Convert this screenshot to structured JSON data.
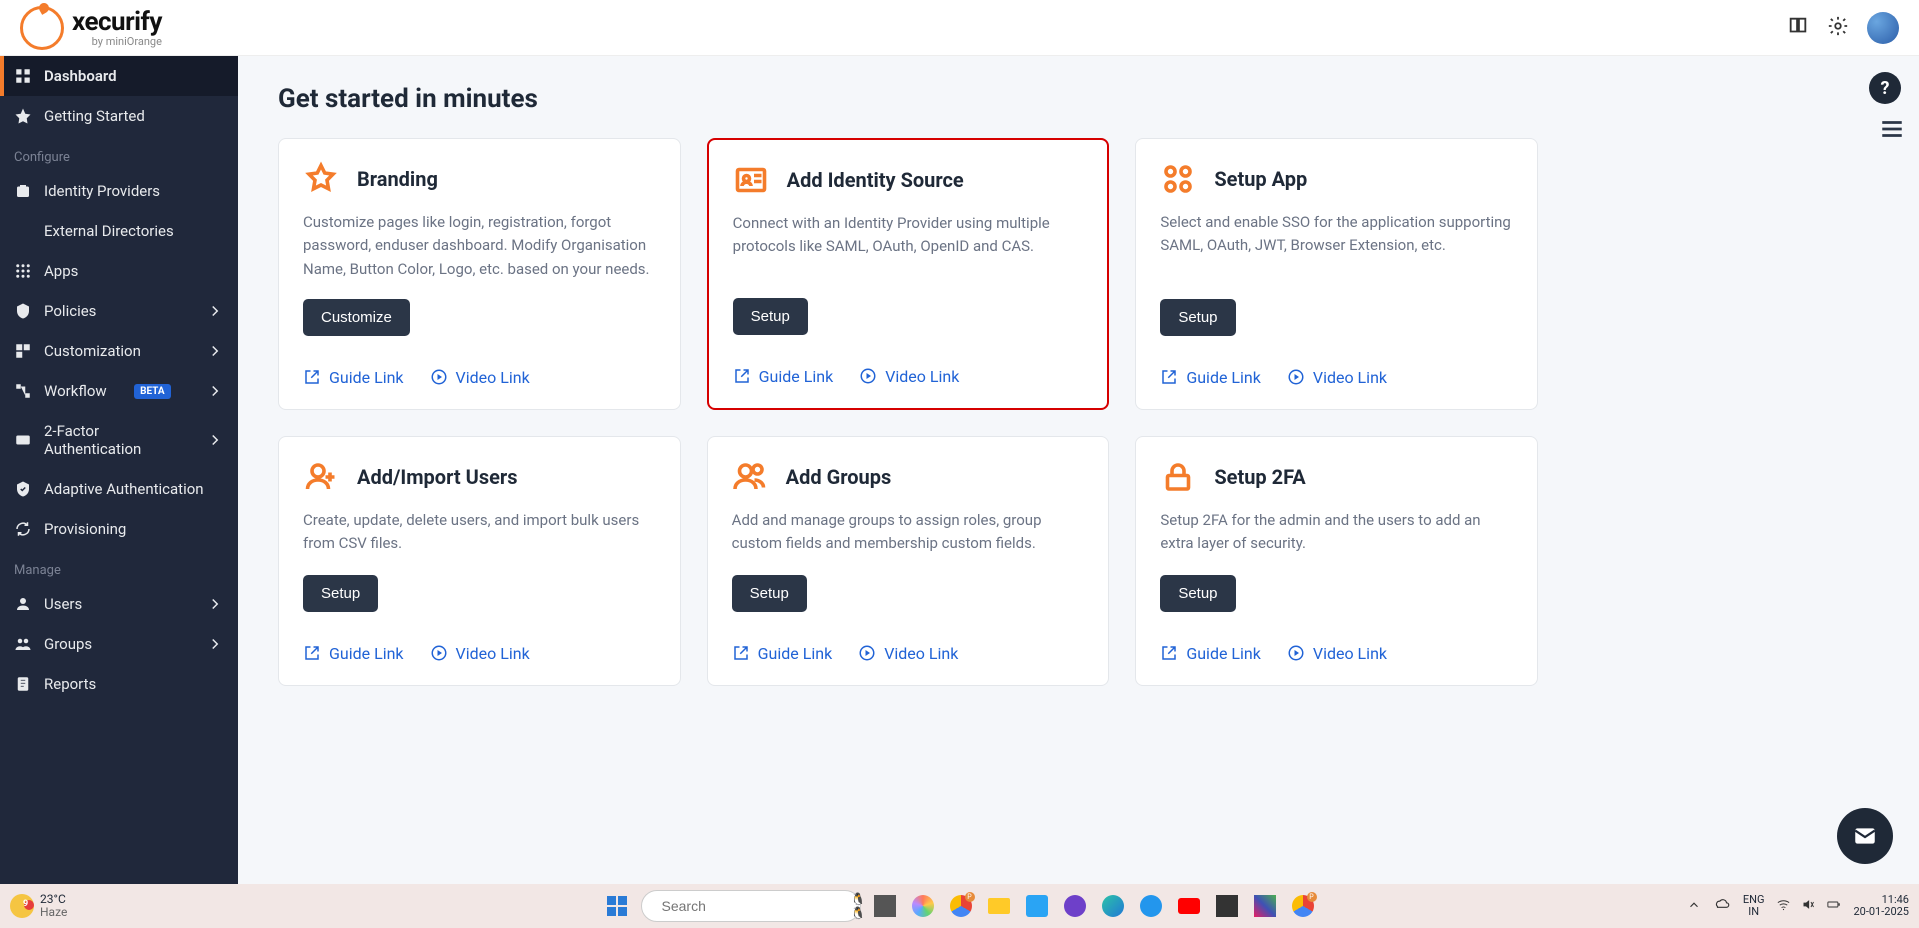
{
  "brand": {
    "name": "xecurify",
    "byline": "by miniOrange"
  },
  "sidebar": {
    "items": [
      {
        "label": "Dashboard",
        "active": true
      },
      {
        "label": "Getting Started"
      }
    ],
    "section_configure": "Configure",
    "configure": [
      {
        "label": "Identity Providers"
      },
      {
        "label": "External Directories"
      },
      {
        "label": "Apps"
      },
      {
        "label": "Policies",
        "expandable": true
      },
      {
        "label": "Customization",
        "expandable": true
      },
      {
        "label": "Workflow",
        "expandable": true,
        "badge": "BETA"
      },
      {
        "label": "2-Factor Authentication",
        "expandable": true
      },
      {
        "label": "Adaptive Authentication"
      },
      {
        "label": "Provisioning"
      }
    ],
    "section_manage": "Manage",
    "manage": [
      {
        "label": "Users",
        "expandable": true
      },
      {
        "label": "Groups",
        "expandable": true
      },
      {
        "label": "Reports"
      }
    ]
  },
  "page_title": "Get started in minutes",
  "cards": [
    {
      "title": "Branding",
      "desc": "Customize pages like login, registration, forgot password, enduser dashboard. Modify Organisation Name, Button Color, Logo, etc. based on your needs.",
      "button": "Customize",
      "guide": "Guide Link",
      "video": "Video Link",
      "highlight": false,
      "icon": "star"
    },
    {
      "title": "Add Identity Source",
      "desc": "Connect with an Identity Provider using multiple protocols like SAML, OAuth, OpenID and CAS.",
      "button": "Setup",
      "guide": "Guide Link",
      "video": "Video Link",
      "highlight": true,
      "icon": "idcard"
    },
    {
      "title": "Setup App",
      "desc": "Select and enable SSO for the application supporting SAML, OAuth, JWT, Browser Extension, etc.",
      "button": "Setup",
      "guide": "Guide Link",
      "video": "Video Link",
      "highlight": false,
      "icon": "apps"
    },
    {
      "title": "Add/Import Users",
      "desc": "Create, update, delete users, and import bulk users from CSV files.",
      "button": "Setup",
      "guide": "Guide Link",
      "video": "Video Link",
      "highlight": false,
      "icon": "useradd"
    },
    {
      "title": "Add Groups",
      "desc": "Add and manage groups to assign roles, group custom fields and membership custom fields.",
      "button": "Setup",
      "guide": "Guide Link",
      "video": "Video Link",
      "highlight": false,
      "icon": "group"
    },
    {
      "title": "Setup 2FA",
      "desc": "Setup 2FA for the admin and the users to add an extra layer of security.",
      "button": "Setup",
      "guide": "Guide Link",
      "video": "Video Link",
      "highlight": false,
      "icon": "lock"
    }
  ],
  "taskbar": {
    "weather": {
      "temp": "23°C",
      "cond": "Haze",
      "badge": "9"
    },
    "search_placeholder": "Search",
    "lang1": "ENG",
    "lang2": "IN",
    "time": "11:46",
    "date": "20-01-2025"
  }
}
